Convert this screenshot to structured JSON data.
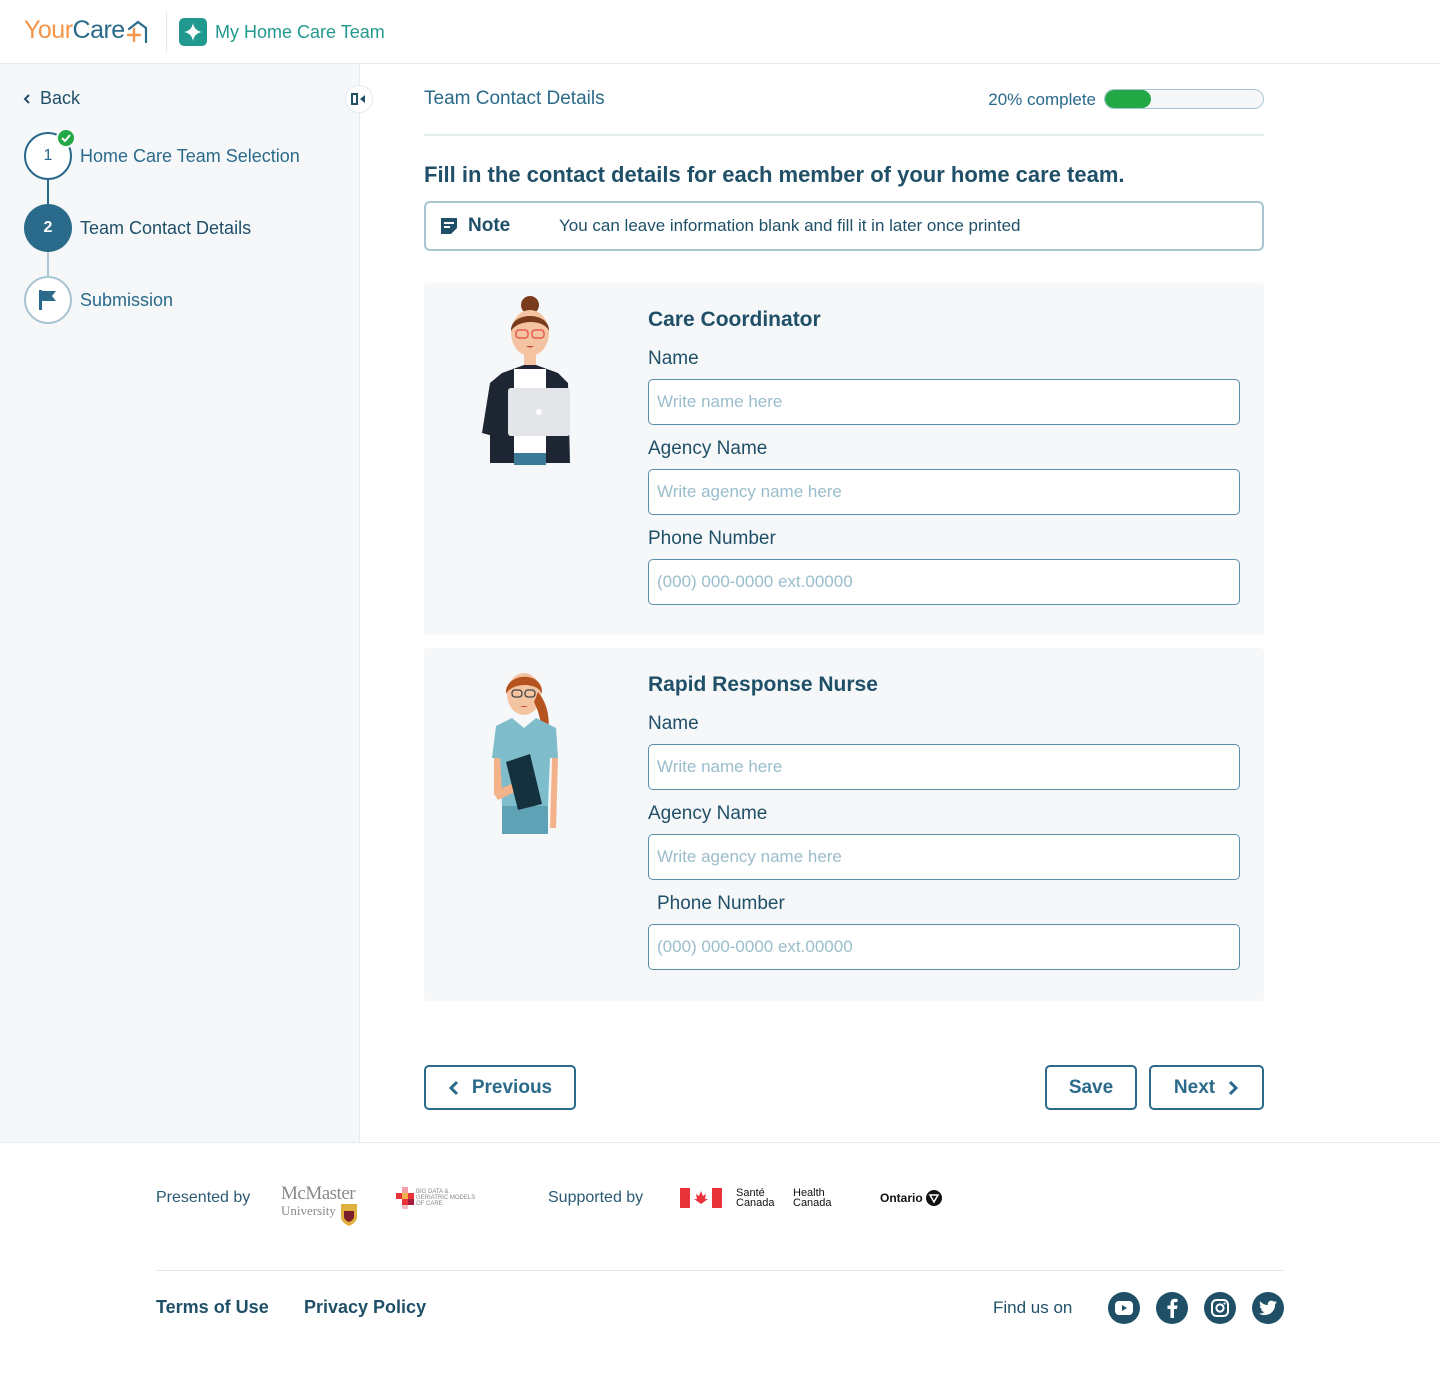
{
  "header": {
    "logo_part1": "Your",
    "logo_part2": "Care",
    "app_name": "My Home Care Team",
    "brand_colors": {
      "orange": "#f5954a",
      "blue": "#2a6a8a",
      "teal": "#22998e"
    }
  },
  "sidebar": {
    "back_label": "Back",
    "collapse_icon": "collapse-sidebar-icon",
    "steps": [
      {
        "number": "1",
        "label": "Home Care Team Selection",
        "status": "completed"
      },
      {
        "number": "2",
        "label": "Team Contact Details",
        "status": "current"
      },
      {
        "number": "",
        "label": "Submission",
        "status": "upcoming",
        "icon": "flag-icon"
      }
    ]
  },
  "main": {
    "page_title": "Team Contact Details",
    "progress": {
      "label": "20% complete",
      "percent": 20,
      "color": "#22a845"
    },
    "instructions": "Fill in the contact details for each member of your home care team.",
    "note": {
      "label": "Note",
      "text": "You can leave information blank and fill it in later once printed"
    },
    "cards": [
      {
        "role": "Care Coordinator",
        "illustration": "care-coordinator-illustration",
        "fields": [
          {
            "label": "Name",
            "value": "",
            "placeholder": "Write name here"
          },
          {
            "label": "Agency Name",
            "value": "",
            "placeholder": "Write agency name here"
          },
          {
            "label": "Phone Number",
            "value": "",
            "placeholder": "(000) 000-0000 ext.00000"
          }
        ]
      },
      {
        "role": "Rapid Response Nurse",
        "illustration": "nurse-illustration",
        "fields": [
          {
            "label": "Name",
            "value": "",
            "placeholder": "Write name here"
          },
          {
            "label": "Agency Name",
            "value": "",
            "placeholder": "Write agency name here"
          },
          {
            "label": "Phone Number",
            "value": "",
            "placeholder": "(000) 000-0000 ext.00000"
          }
        ]
      }
    ],
    "buttons": {
      "previous": "Previous",
      "save": "Save",
      "next": "Next"
    }
  },
  "footer": {
    "presented_by": "Presented by",
    "mcmaster_line1": "McMaster",
    "mcmaster_line2": "University",
    "bigdata_lines": [
      "BIG DATA &",
      "GERIATRIC MODELS",
      "OF CARE"
    ],
    "supported_by": "Supported by",
    "sante_line1": "Santé",
    "sante_line2": "Canada",
    "health_line1": "Health",
    "health_line2": "Canada",
    "ontario": "Ontario",
    "links": {
      "terms": "Terms of Use",
      "privacy": "Privacy Policy"
    },
    "find_us": "Find us on",
    "social": [
      "youtube",
      "facebook",
      "instagram",
      "twitter"
    ]
  }
}
